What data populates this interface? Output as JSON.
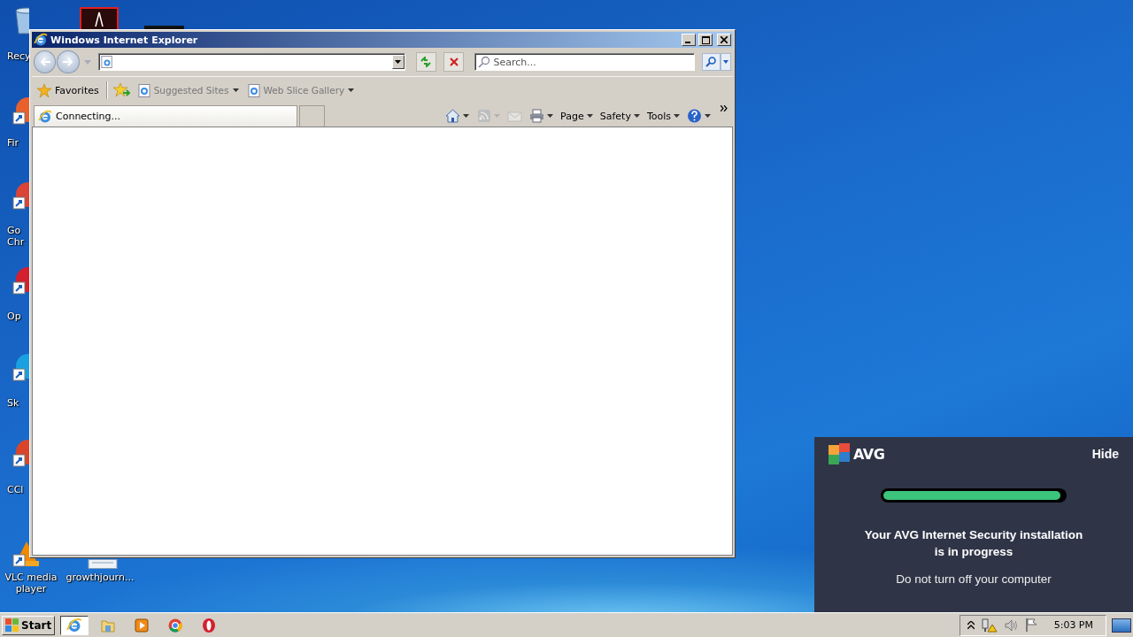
{
  "desktop_icons": [
    {
      "kind": "bin",
      "label": "Recy"
    },
    {
      "kind": "pdf"
    },
    {
      "kind": "dark"
    },
    {
      "kind": "firefox",
      "label": "Fir"
    },
    {
      "kind": "chrome",
      "label": "Go Chr"
    },
    {
      "kind": "opera",
      "label": "Op"
    },
    {
      "kind": "skype",
      "label": "Sk"
    },
    {
      "kind": "ccleaner",
      "label": "CCl"
    },
    {
      "kind": "vlc",
      "label": "VLC media player"
    },
    {
      "kind": "document",
      "label": "growthjourn..."
    }
  ],
  "browser": {
    "title": "Windows Internet Explorer",
    "search": {
      "placeholder": "Search..."
    },
    "favorites_bar": {
      "favorites": "Favorites",
      "links": [
        {
          "label": "Suggested Sites",
          "disabled": true
        },
        {
          "label": "Web Slice Gallery",
          "disabled": true
        }
      ]
    },
    "tabs": [
      {
        "label": "Connecting...",
        "selected": true
      }
    ],
    "command_bar": [
      {
        "kind": "home",
        "disabled": false
      },
      {
        "kind": "feeds",
        "disabled": true
      },
      {
        "kind": "mail",
        "disabled": true
      },
      {
        "kind": "print",
        "disabled": false
      },
      {
        "kind": "menu",
        "label": "Page",
        "disabled": false
      },
      {
        "kind": "menu",
        "label": "Safety",
        "disabled": false
      },
      {
        "kind": "menu",
        "label": "Tools",
        "disabled": false
      },
      {
        "kind": "help",
        "disabled": false
      }
    ]
  },
  "avg": {
    "brand": "AVG",
    "hide": "Hide",
    "progress": {
      "level": 0.98
    },
    "message": "Your AVG Internet Security installation is in progress",
    "note": "Do not turn off your computer"
  },
  "taskbar": {
    "start": "Start",
    "apps": [
      {
        "kind": "ie",
        "selected": true
      },
      {
        "kind": "folder",
        "selected": false
      },
      {
        "kind": "media",
        "selected": false
      },
      {
        "kind": "chrome",
        "selected": false
      },
      {
        "kind": "opera",
        "selected": false
      }
    ],
    "tray": {
      "clock": "5:03 PM"
    }
  }
}
